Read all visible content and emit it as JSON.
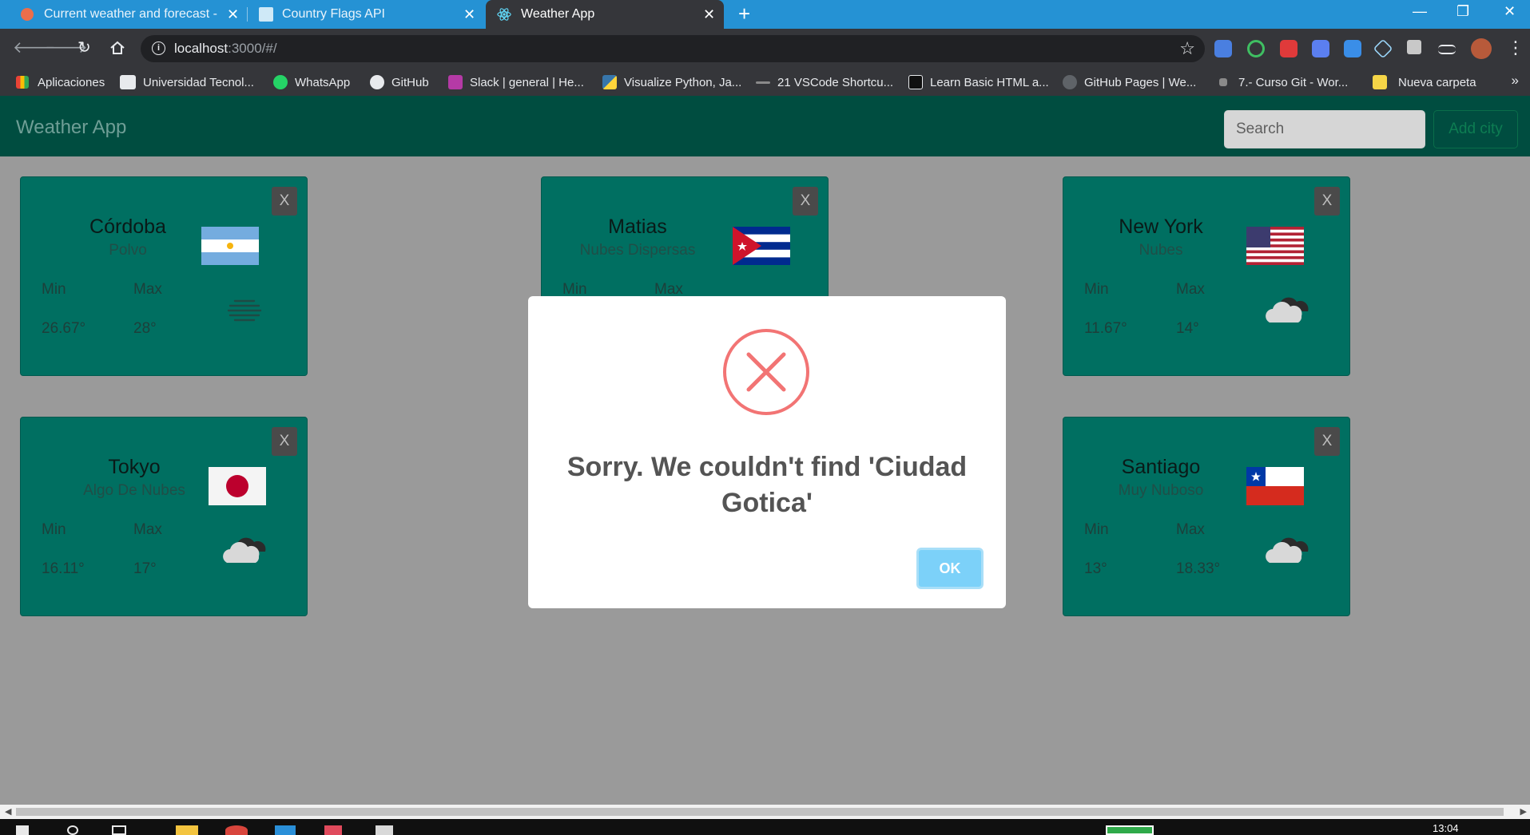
{
  "browser": {
    "tabs": [
      {
        "title": "Current weather and forecast - O",
        "active": false
      },
      {
        "title": "Country Flags API",
        "active": false
      },
      {
        "title": "Weather App",
        "active": true
      }
    ],
    "url_host": "localhost",
    "url_rest": ":3000/#/",
    "window_controls": {
      "minimize": "—",
      "maximize": "❐",
      "close": "✕"
    }
  },
  "bookmarks": [
    "Aplicaciones",
    "Universidad Tecnol...",
    "WhatsApp",
    "GitHub",
    "Slack | general | He...",
    "Visualize Python, Ja...",
    "21 VSCode Shortcu...",
    "Learn Basic HTML a...",
    "GitHub Pages | We...",
    "7.- Curso Git - Wor...",
    "Nueva carpeta"
  ],
  "app": {
    "brand": "Weather App",
    "search_placeholder": "Search",
    "add_city": "Add city",
    "close_label": "X",
    "min_label": "Min",
    "max_label": "Max"
  },
  "cards": [
    {
      "city": "Córdoba",
      "desc": "Polvo",
      "min": "26.67°",
      "max": "28°",
      "flag": "argentina",
      "icon": "haze-icon"
    },
    {
      "city": "Matias",
      "desc": "Nubes Dispersas",
      "min": "",
      "max": "",
      "flag": "cuba",
      "icon": ""
    },
    {
      "city": "New York",
      "desc": "Nubes",
      "min": "11.67°",
      "max": "14°",
      "flag": "usa",
      "icon": "cloud-icon"
    },
    {
      "city": "Tokyo",
      "desc": "Algo De Nubes",
      "min": "16.11°",
      "max": "17°",
      "flag": "japan",
      "icon": "cloud-icon"
    },
    {
      "city": "Santiago",
      "desc": "Muy Nuboso",
      "min": "13°",
      "max": "18.33°",
      "flag": "chile",
      "icon": "cloud-icon"
    }
  ],
  "modal": {
    "message": "Sorry. We couldn't find 'Ciudad Gotica'",
    "ok": "OK",
    "icon": "error-x-icon"
  },
  "taskbar": {
    "time": "13:04"
  },
  "colors": {
    "chrome_blue": "#2592d4",
    "app_nav": "#004d40",
    "card": "#006f61",
    "error_red": "#f27474",
    "ok_button": "#7cd1f9"
  }
}
